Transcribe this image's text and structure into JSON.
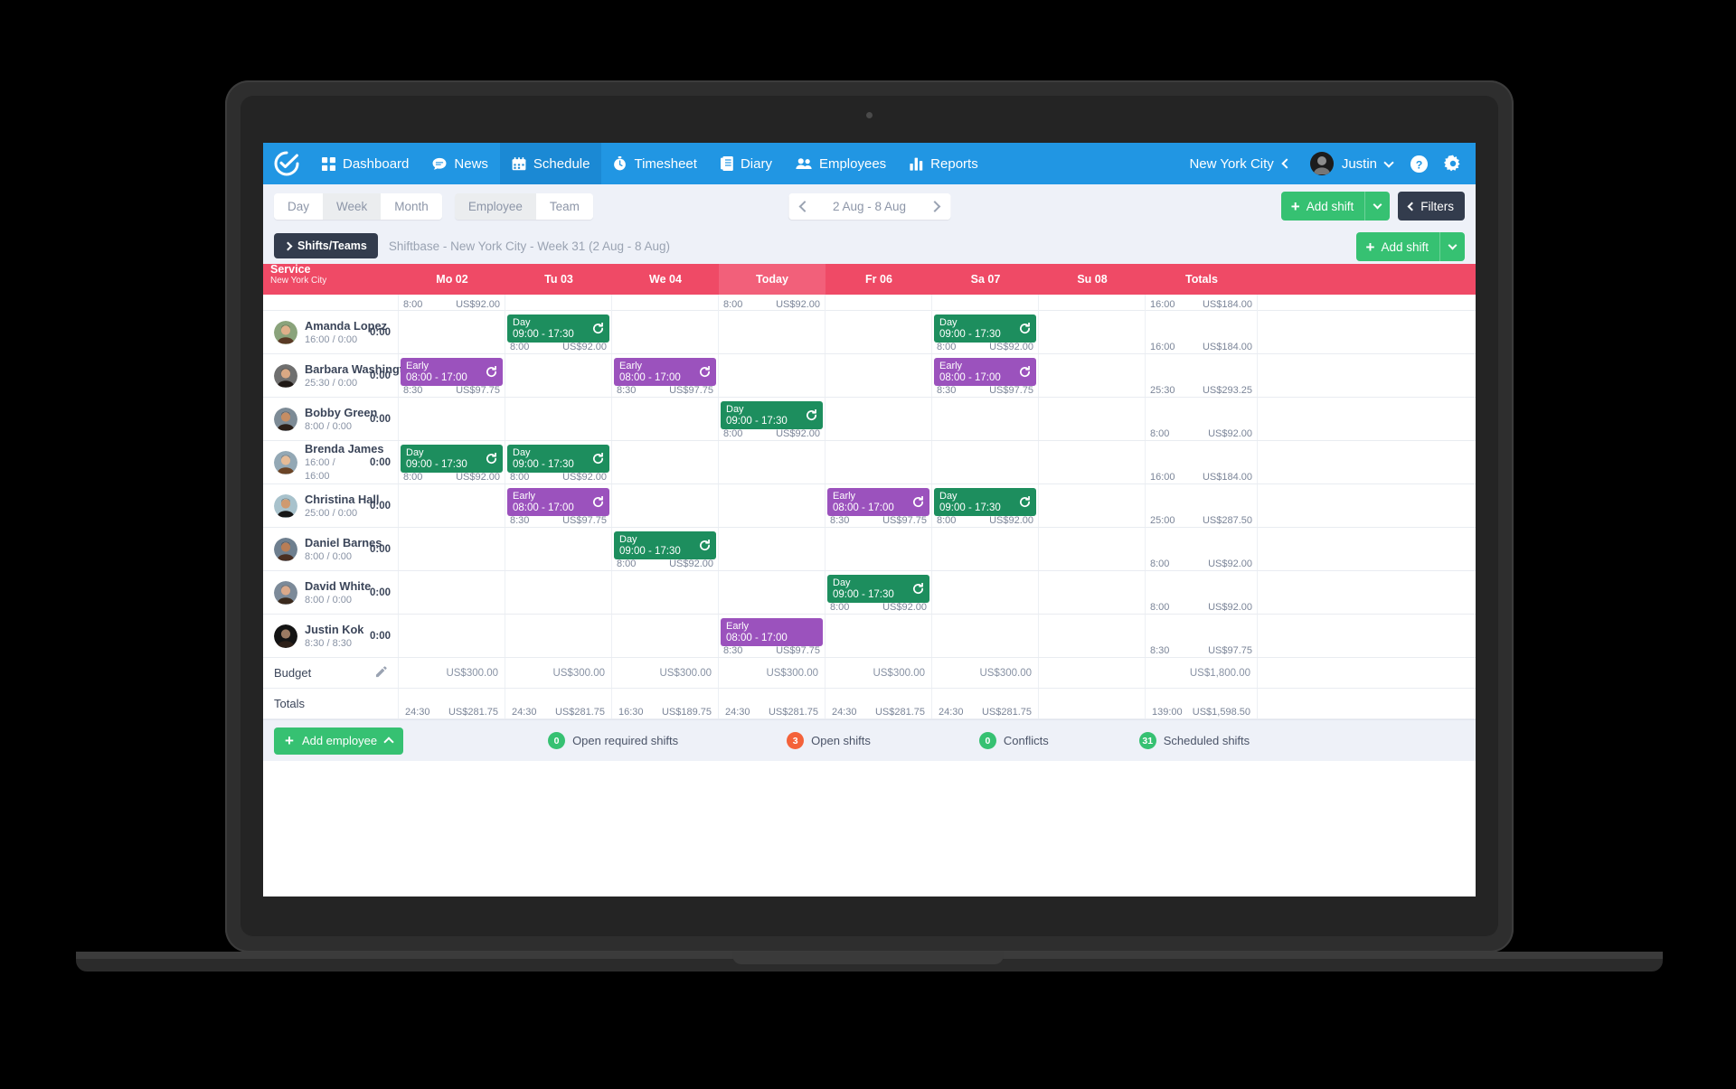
{
  "nav": {
    "logo_icon": "check-circle-logo",
    "items": [
      {
        "label": "Dashboard",
        "icon": "grid-icon",
        "active": false
      },
      {
        "label": "News",
        "icon": "chat-bubble-icon",
        "active": false
      },
      {
        "label": "Schedule",
        "icon": "calendar-icon",
        "active": true
      },
      {
        "label": "Timesheet",
        "icon": "stopwatch-icon",
        "active": false
      },
      {
        "label": "Diary",
        "icon": "notebook-icon",
        "active": false
      },
      {
        "label": "Employees",
        "icon": "people-icon",
        "active": false
      },
      {
        "label": "Reports",
        "icon": "bar-chart-icon",
        "active": false
      }
    ],
    "location": "New York City",
    "user": "Justin",
    "help_icon": "question-mark-icon",
    "settings_icon": "gear-icon",
    "accent": "#2196e3"
  },
  "toolbar": {
    "view_modes": [
      {
        "label": "Day",
        "active": false
      },
      {
        "label": "Week",
        "active": true
      },
      {
        "label": "Month",
        "active": false
      }
    ],
    "group_modes": [
      {
        "label": "Employee",
        "active": true
      },
      {
        "label": "Team",
        "active": false
      }
    ],
    "date_range": "2 Aug - 8 Aug",
    "prev_icon": "chevron-left-icon",
    "next_icon": "chevron-right-icon",
    "add_shift": "Add shift",
    "filters": "Filters"
  },
  "panel": {
    "shifts_teams": "Shifts/Teams",
    "title": "Shiftbase - New York City - Week 31 (2 Aug - 8 Aug)",
    "add_shift": "Add shift"
  },
  "grid": {
    "service_label": "Service",
    "service_sub": "New York City",
    "header_cols": [
      "Mo 02",
      "Tu 03",
      "We 04",
      "Today",
      "Fr 06",
      "Sa 07",
      "Su 08"
    ],
    "totals_header": "Totals",
    "top_partial": [
      {
        "hours": "8:00",
        "cost": "US$92.00"
      },
      null,
      null,
      {
        "hours": "8:00",
        "cost": "US$92.00"
      },
      null,
      null,
      null
    ],
    "top_partial_total": {
      "hours": "16:00",
      "cost": "US$184.00"
    },
    "rows": [
      {
        "name": "Amanda Lopez",
        "contract": "16:00 / 0:00",
        "worked": "0:00",
        "days": [
          null,
          {
            "type": "Day",
            "time": "09:00 - 17:30",
            "color": "green",
            "recurring": true,
            "hours": "8:00",
            "cost": "US$92.00"
          },
          null,
          null,
          null,
          {
            "type": "Day",
            "time": "09:00 - 17:30",
            "color": "green",
            "recurring": true,
            "hours": "8:00",
            "cost": "US$92.00"
          },
          null
        ],
        "total": {
          "hours": "16:00",
          "cost": "US$184.00"
        }
      },
      {
        "name": "Barbara Washington",
        "contract": "25:30 / 0:00",
        "worked": "0:00",
        "days": [
          {
            "type": "Early",
            "time": "08:00 - 17:00",
            "color": "purple",
            "recurring": true,
            "hours": "8:30",
            "cost": "US$97.75"
          },
          null,
          {
            "type": "Early",
            "time": "08:00 - 17:00",
            "color": "purple",
            "recurring": true,
            "hours": "8:30",
            "cost": "US$97.75"
          },
          null,
          null,
          {
            "type": "Early",
            "time": "08:00 - 17:00",
            "color": "purple",
            "recurring": true,
            "hours": "8:30",
            "cost": "US$97.75"
          },
          null
        ],
        "total": {
          "hours": "25:30",
          "cost": "US$293.25"
        }
      },
      {
        "name": "Bobby Green",
        "contract": "8:00 / 0:00",
        "worked": "0:00",
        "days": [
          null,
          null,
          null,
          {
            "type": "Day",
            "time": "09:00 - 17:30",
            "color": "green",
            "recurring": true,
            "hours": "8:00",
            "cost": "US$92.00"
          },
          null,
          null,
          null
        ],
        "total": {
          "hours": "8:00",
          "cost": "US$92.00"
        }
      },
      {
        "name": "Brenda James",
        "contract": "16:00 / 16:00",
        "worked": "0:00",
        "days": [
          {
            "type": "Day",
            "time": "09:00 - 17:30",
            "color": "green",
            "recurring": true,
            "hours": "8:00",
            "cost": "US$92.00"
          },
          {
            "type": "Day",
            "time": "09:00 - 17:30",
            "color": "green",
            "recurring": true,
            "hours": "8:00",
            "cost": "US$92.00"
          },
          null,
          null,
          null,
          null,
          null
        ],
        "total": {
          "hours": "16:00",
          "cost": "US$184.00"
        }
      },
      {
        "name": "Christina Hall",
        "contract": "25:00 / 0:00",
        "worked": "0:00",
        "days": [
          null,
          {
            "type": "Early",
            "time": "08:00 - 17:00",
            "color": "purple",
            "recurring": true,
            "hours": "8:30",
            "cost": "US$97.75"
          },
          null,
          null,
          {
            "type": "Early",
            "time": "08:00 - 17:00",
            "color": "purple",
            "recurring": true,
            "hours": "8:30",
            "cost": "US$97.75"
          },
          {
            "type": "Day",
            "time": "09:00 - 17:30",
            "color": "green",
            "recurring": true,
            "hours": "8:00",
            "cost": "US$92.00"
          },
          null
        ],
        "total": {
          "hours": "25:00",
          "cost": "US$287.50"
        }
      },
      {
        "name": "Daniel Barnes",
        "contract": "8:00 / 0:00",
        "worked": "0:00",
        "days": [
          null,
          null,
          {
            "type": "Day",
            "time": "09:00 - 17:30",
            "color": "green",
            "recurring": true,
            "hours": "8:00",
            "cost": "US$92.00"
          },
          null,
          null,
          null,
          null
        ],
        "total": {
          "hours": "8:00",
          "cost": "US$92.00"
        }
      },
      {
        "name": "David White",
        "contract": "8:00 / 0:00",
        "worked": "0:00",
        "days": [
          null,
          null,
          null,
          null,
          {
            "type": "Day",
            "time": "09:00 - 17:30",
            "color": "green",
            "recurring": true,
            "hours": "8:00",
            "cost": "US$92.00"
          },
          null,
          null
        ],
        "total": {
          "hours": "8:00",
          "cost": "US$92.00"
        }
      },
      {
        "name": "Justin Kok",
        "contract": "8:30 / 8:30",
        "worked": "0:00",
        "days": [
          null,
          null,
          null,
          {
            "type": "Early",
            "time": "08:00 - 17:00",
            "color": "purple",
            "recurring": false,
            "hours": "8:30",
            "cost": "US$97.75"
          },
          null,
          null,
          null
        ],
        "total": {
          "hours": "8:30",
          "cost": "US$97.75"
        }
      }
    ],
    "budget": {
      "label": "Budget",
      "edit_icon": "pencil-icon",
      "values": [
        "US$300.00",
        "US$300.00",
        "US$300.00",
        "US$300.00",
        "US$300.00",
        "US$300.00",
        ""
      ],
      "total": "US$1,800.00"
    },
    "totals": {
      "label": "Totals",
      "values": [
        {
          "hours": "24:30",
          "cost": "US$281.75"
        },
        {
          "hours": "24:30",
          "cost": "US$281.75"
        },
        {
          "hours": "16:30",
          "cost": "US$189.75"
        },
        {
          "hours": "24:30",
          "cost": "US$281.75"
        },
        {
          "hours": "24:30",
          "cost": "US$281.75"
        },
        {
          "hours": "24:30",
          "cost": "US$281.75"
        },
        {
          "hours": "",
          "cost": ""
        }
      ],
      "total": {
        "hours": "139:00",
        "cost": "US$1,598.50"
      }
    },
    "colors": {
      "header": "#ef4a66",
      "today": "#f2607a",
      "green": "#1d8e5e",
      "purple": "#9b52bd"
    }
  },
  "footer": {
    "add_employee": "Add employee",
    "stats": [
      {
        "count": "0",
        "label": "Open required shifts",
        "color": "#36c172"
      },
      {
        "count": "3",
        "label": "Open shifts",
        "color": "#f4623a"
      },
      {
        "count": "0",
        "label": "Conflicts",
        "color": "#36c172"
      },
      {
        "count": "31",
        "label": "Scheduled shifts",
        "color": "#36c172"
      }
    ]
  }
}
